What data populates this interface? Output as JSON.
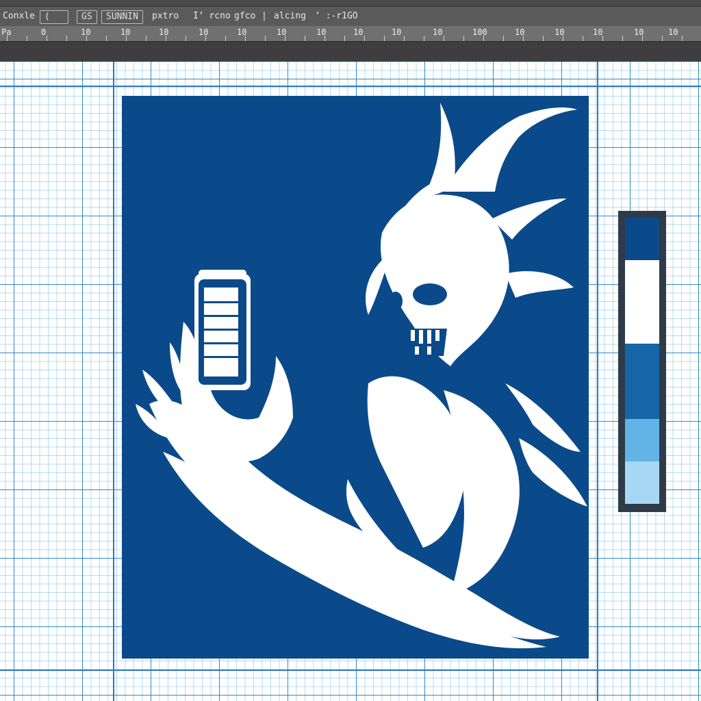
{
  "menu": {
    "items": [
      "Conxle",
      "(",
      "GS",
      "SUNNIN",
      "pxtro",
      "I’ rcno",
      "gfco",
      "|",
      "alcing",
      "’ :-r1GO"
    ]
  },
  "ruler": {
    "labels": [
      "Pa",
      "0",
      "10",
      "10",
      "10",
      "10",
      "10",
      "10",
      "10",
      "10",
      "10",
      "10",
      "10",
      "10",
      "100",
      "10",
      "10",
      "10",
      "10",
      "10",
      "10",
      "10"
    ]
  },
  "swatches": [
    {
      "name": "navy",
      "color": "#0b4a8a"
    },
    {
      "name": "white",
      "color": "#ffffff"
    },
    {
      "name": "blue",
      "color": "#1466a8"
    },
    {
      "name": "light-blue",
      "color": "#62b3e6"
    },
    {
      "name": "pale-blue",
      "color": "#a7d8f3"
    }
  ],
  "artwork": {
    "background_color": "#0b4a8a",
    "figure_color": "#ffffff",
    "subject": "flaming-creature-holding-can"
  }
}
